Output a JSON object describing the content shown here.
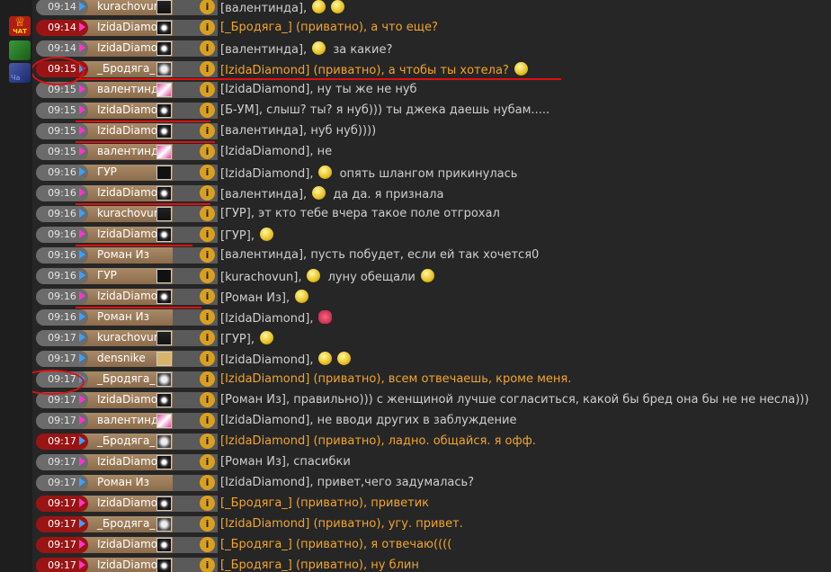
{
  "sidebar": {
    "chat_badge_label": "ЧАТ",
    "tab3_label": "Ча"
  },
  "colors": {
    "private_message": "#f2a52c",
    "normal_message": "#cfcfcf",
    "private_time_bg": "#9a1414",
    "annotation_red": "#e01010"
  },
  "rows": [
    {
      "time": "09:14",
      "user": "kurachovun",
      "avatar": "dark",
      "private": false,
      "pm": false,
      "text": "[валентинда],",
      "smiles": 2
    },
    {
      "time": "09:14",
      "user": "IzidaDiamond",
      "avatar": "eye",
      "private": true,
      "pm": true,
      "text": "[_Бродяга_] (приватно), а что еще?",
      "smiles": 0
    },
    {
      "time": "09:14",
      "user": "IzidaDiamond",
      "avatar": "eye",
      "private": false,
      "pm": true,
      "text": "[валентинда],",
      "text2": "за какие?",
      "smiles": 1
    },
    {
      "time": "09:15",
      "user": "_Бродяга_",
      "avatar": "ghost",
      "private": true,
      "pm": false,
      "text": "[IzidaDiamond] (приватно), а чтобы ты хотела?",
      "smiles": 1
    },
    {
      "time": "09:15",
      "user": "валентинда",
      "avatar": "pink",
      "private": false,
      "pm": true,
      "text": "[IzidaDiamond], ну ты же не нуб",
      "smiles": 0
    },
    {
      "time": "09:15",
      "user": "IzidaDiamond",
      "avatar": "eye",
      "private": false,
      "pm": true,
      "text": "[Б-УМ], слыш? ты? я нуб))) ты джека даешь нубам.....",
      "smiles": 0
    },
    {
      "time": "09:15",
      "user": "IzidaDiamond",
      "avatar": "eye",
      "private": false,
      "pm": true,
      "text": "[валентинда], нуб нуб))))",
      "smiles": 0
    },
    {
      "time": "09:15",
      "user": "валентинда",
      "avatar": "pink",
      "private": false,
      "pm": true,
      "text": "[IzidaDiamond], не",
      "smiles": 0
    },
    {
      "time": "09:16",
      "user": "ГУР",
      "avatar": "skull",
      "private": false,
      "pm": false,
      "text": "[IzidaDiamond],",
      "text2": "опять шлангом прикинулась",
      "smiles": 1
    },
    {
      "time": "09:16",
      "user": "IzidaDiamond",
      "avatar": "eye",
      "private": false,
      "pm": true,
      "text": "[валентинда],",
      "text2": "да да. я признала",
      "smiles": 1
    },
    {
      "time": "09:16",
      "user": "kurachovun",
      "avatar": "dark",
      "private": false,
      "pm": false,
      "text": "[ГУР], эт кто тебе вчера такое поле отгрохал",
      "smiles": 0
    },
    {
      "time": "09:16",
      "user": "IzidaDiamond",
      "avatar": "eye",
      "private": false,
      "pm": true,
      "text": "[ГУР],",
      "smiles": 1
    },
    {
      "time": "09:16",
      "user": "Роман Из",
      "avatar": "none",
      "private": false,
      "pm": false,
      "text": "[валентинда], пусть побудет, если ей так хочется0",
      "smiles": 0
    },
    {
      "time": "09:16",
      "user": "ГУР",
      "avatar": "skull",
      "private": false,
      "pm": false,
      "text": "[kurachovun],",
      "text2": "луну обещали",
      "smiles": 2
    },
    {
      "time": "09:16",
      "user": "IzidaDiamond",
      "avatar": "eye",
      "private": false,
      "pm": true,
      "text": "[Роман Из],",
      "smiles": 1
    },
    {
      "time": "09:16",
      "user": "Роман Из",
      "avatar": "none",
      "private": false,
      "pm": false,
      "text": "[IzidaDiamond],",
      "smiles": 1,
      "rose": true
    },
    {
      "time": "09:17",
      "user": "kurachovun",
      "avatar": "dark",
      "private": false,
      "pm": false,
      "text": "[ГУР],",
      "smiles": 1
    },
    {
      "time": "09:17",
      "user": "densnike",
      "avatar": "bat",
      "private": false,
      "pm": false,
      "text": "[IzidaDiamond],",
      "smiles": 2
    },
    {
      "time": "09:17",
      "user": "_Бродяга_",
      "avatar": "ghost",
      "private": false,
      "pm": false,
      "text": "[IzidaDiamond] (приватно), всем отвечаешь, кроме меня.",
      "smiles": 0,
      "orange": true
    },
    {
      "time": "09:17",
      "user": "IzidaDiamond",
      "avatar": "eye",
      "private": false,
      "pm": true,
      "text": "[Роман Из], правильно))) с женщиной лучше согласиться, какой бы бред она бы не не несла)))",
      "smiles": 0
    },
    {
      "time": "09:17",
      "user": "валентинда",
      "avatar": "pink",
      "private": false,
      "pm": true,
      "text": "[IzidaDiamond], не вводи других в заблуждение",
      "smiles": 0
    },
    {
      "time": "09:17",
      "user": "_Бродяга_",
      "avatar": "ghost",
      "private": true,
      "pm": false,
      "text": "[IzidaDiamond] (приватно), ладно. общайся. я офф.",
      "smiles": 0
    },
    {
      "time": "09:17",
      "user": "IzidaDiamond",
      "avatar": "eye",
      "private": false,
      "pm": true,
      "text": "[Роман Из], спасибки",
      "smiles": 0
    },
    {
      "time": "09:17",
      "user": "Роман Из",
      "avatar": "none",
      "private": false,
      "pm": false,
      "text": "[IzidaDiamond], привет,чего задумалась?",
      "smiles": 0
    },
    {
      "time": "09:17",
      "user": "IzidaDiamond",
      "avatar": "eye",
      "private": true,
      "pm": true,
      "text": "[_Бродяга_] (приватно), приветик",
      "smiles": 0
    },
    {
      "time": "09:17",
      "user": "_Бродяга_",
      "avatar": "ghost",
      "private": true,
      "pm": false,
      "text": "[IzidaDiamond] (приватно), угу. привет.",
      "smiles": 0
    },
    {
      "time": "09:17",
      "user": "IzidaDiamond",
      "avatar": "eye",
      "private": true,
      "pm": true,
      "text": "[_Бродяга_] (приватно), я отвечаю((((",
      "smiles": 0
    },
    {
      "time": "09:17",
      "user": "IzidaDiamond",
      "avatar": "eye",
      "private": true,
      "pm": true,
      "text": "[_Бродяга_] (приватно), ну блин",
      "smiles": 0
    }
  ]
}
